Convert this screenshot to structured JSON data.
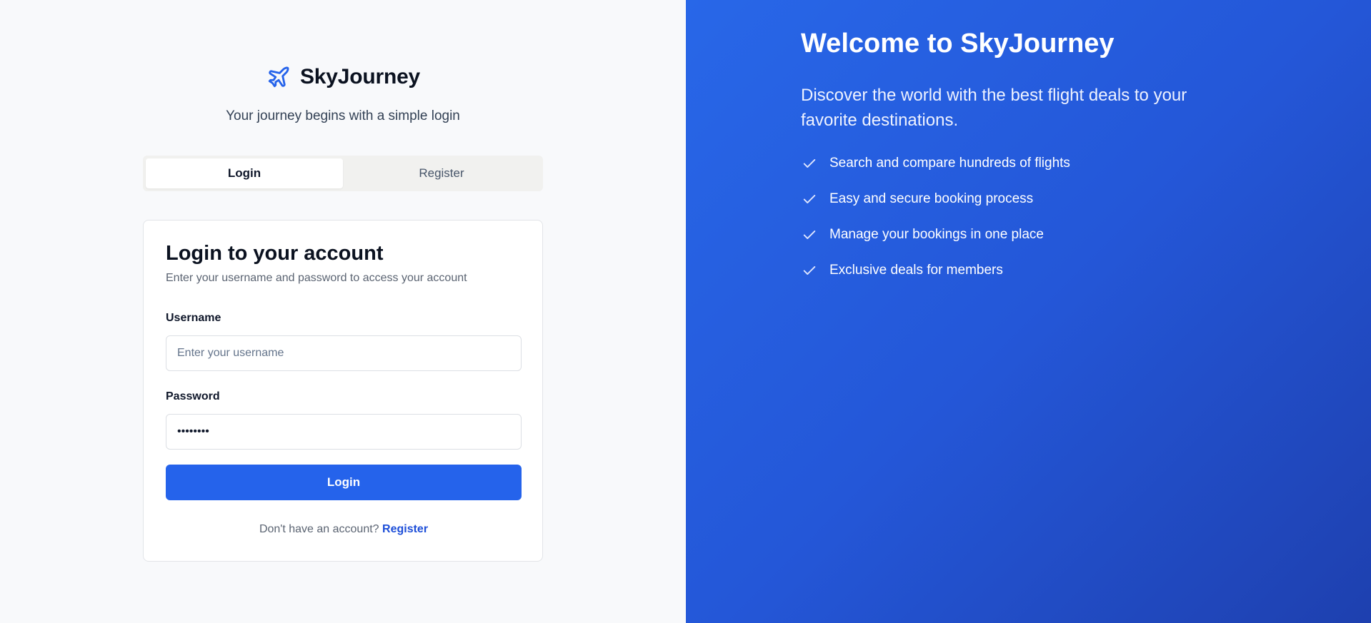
{
  "brand": {
    "name": "SkyJourney",
    "tagline": "Your journey begins with a simple login",
    "icon": "plane-icon"
  },
  "tabs": [
    {
      "label": "Login",
      "active": true
    },
    {
      "label": "Register",
      "active": false
    }
  ],
  "login_card": {
    "title": "Login to your account",
    "subtitle": "Enter your username and password to access your account",
    "username": {
      "label": "Username",
      "placeholder": "Enter your username",
      "value": ""
    },
    "password": {
      "label": "Password",
      "value": "••••••••"
    },
    "submit_label": "Login",
    "footer_text": "Don't have an account?",
    "footer_link": "Register"
  },
  "hero": {
    "title": "Welcome to SkyJourney",
    "subtitle": "Discover the world with the best flight deals to your favorite destinations.",
    "features": [
      "Search and compare hundreds of flights",
      "Easy and secure booking process",
      "Manage your bookings in one place",
      "Exclusive deals for members"
    ]
  },
  "colors": {
    "accent": "#2563eb",
    "link": "#1d4ed8",
    "hero_start": "#2867e8",
    "hero_end": "#1e40af"
  }
}
